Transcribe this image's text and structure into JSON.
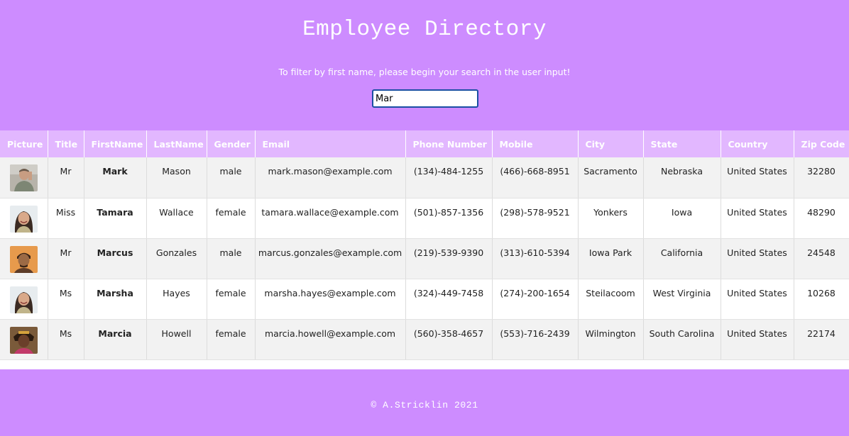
{
  "header": {
    "title": "Employee Directory",
    "instructions": "To filter by first name, please begin your search in the user input!"
  },
  "search": {
    "value": "Mar"
  },
  "table": {
    "columns": [
      "Picture",
      "Title",
      "FirstName",
      "LastName",
      "Gender",
      "Email",
      "Phone Number",
      "Mobile",
      "City",
      "State",
      "Country",
      "Zip Code"
    ],
    "rows": [
      {
        "avatar": "avatar-photo-man-gray-shirt",
        "title": "Mr",
        "first": "Mark",
        "last": "Mason",
        "gender": "male",
        "email": "mark.mason@example.com",
        "phone": "(134)-484-1255",
        "mobile": "(466)-668-8951",
        "city": "Sacramento",
        "state": "Nebraska",
        "country": "United States",
        "zip": "32280"
      },
      {
        "avatar": "avatar-photo-woman-smiling",
        "title": "Miss",
        "first": "Tamara",
        "last": "Wallace",
        "gender": "female",
        "email": "tamara.wallace@example.com",
        "phone": "(501)-857-1356",
        "mobile": "(298)-578-9521",
        "city": "Yonkers",
        "state": "Iowa",
        "country": "United States",
        "zip": "48290"
      },
      {
        "avatar": "avatar-photo-man-orange-background",
        "title": "Mr",
        "first": "Marcus",
        "last": "Gonzales",
        "gender": "male",
        "email": "marcus.gonzales@example.com",
        "phone": "(219)-539-9390",
        "mobile": "(313)-610-5394",
        "city": "Iowa Park",
        "state": "California",
        "country": "United States",
        "zip": "24548"
      },
      {
        "avatar": "avatar-photo-woman-smiling",
        "title": "Ms",
        "first": "Marsha",
        "last": "Hayes",
        "gender": "female",
        "email": "marsha.hayes@example.com",
        "phone": "(324)-449-7458",
        "mobile": "(274)-200-1654",
        "city": "Steilacoom",
        "state": "West Virginia",
        "country": "United States",
        "zip": "10268"
      },
      {
        "avatar": "avatar-photo-woman-dark-hair",
        "title": "Ms",
        "first": "Marcia",
        "last": "Howell",
        "gender": "female",
        "email": "marcia.howell@example.com",
        "phone": "(560)-358-4657",
        "mobile": "(553)-716-2439",
        "city": "Wilmington",
        "state": "South Carolina",
        "country": "United States",
        "zip": "22174"
      }
    ]
  },
  "footer": {
    "copyright": "© A.Stricklin 2021"
  },
  "colors": {
    "brand": "#cd8cff",
    "table_header": "#e2b7ff",
    "row_alt": "#f2f2f2"
  }
}
